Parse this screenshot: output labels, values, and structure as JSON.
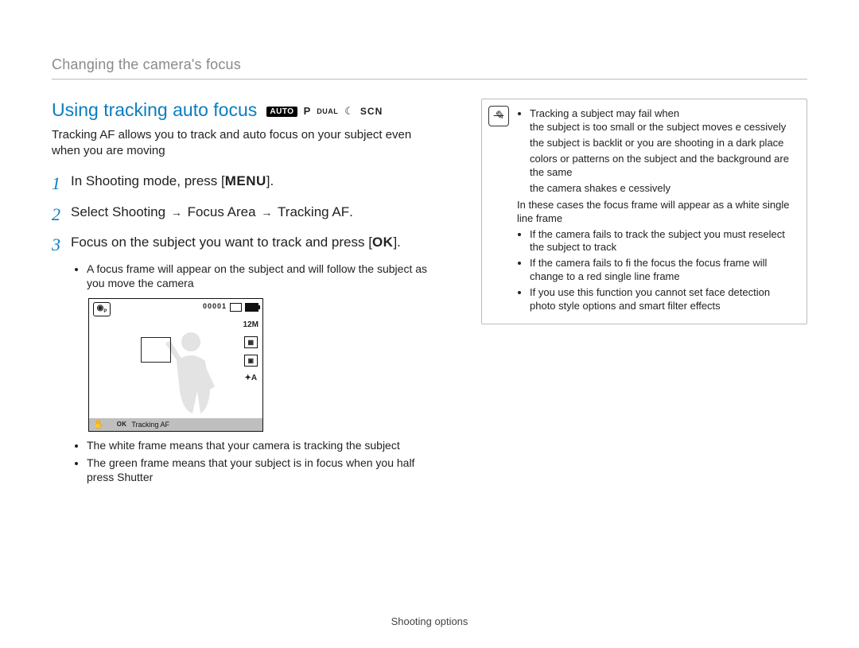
{
  "breadcrumb": "Changing the camera's focus",
  "section_title": "Using tracking auto focus",
  "mode_badges": {
    "auto": "AUTO",
    "p": "P",
    "dual": "DUAL",
    "moon": "☾",
    "scn": "SCN"
  },
  "intro": "Tracking AF allows you to track and auto focus on your subject even when you are moving",
  "steps": {
    "s1": {
      "num": "1",
      "pre": "In Shooting mode, press [",
      "key": "MENU",
      "post": "]."
    },
    "s2": {
      "num": "2",
      "pre": "Select ",
      "b1": "Shooting",
      "arrow": "→",
      "b2": "Focus Area",
      "b3": "Tracking AF",
      "post": "."
    },
    "s3": {
      "num": "3",
      "pre": "Focus on the subject you want to track and press [",
      "key": "OK",
      "post": "].",
      "sub1": "A focus frame will appear on the subject and will follow the subject as you move the camera"
    }
  },
  "lcd": {
    "counter": "00001",
    "res": "12M",
    "flash": "✦A",
    "bottom_ok": "OK",
    "bottom_label": "Tracking AF"
  },
  "after_lcd": {
    "b1": "The white frame means that your camera is tracking the subject",
    "b2_pre": "The green frame means that your subject is in focus when you half press ",
    "b2_bold": "Shutter"
  },
  "note": {
    "lead": "Tracking a subject may fail when",
    "reasons": [
      "the subject is too small or the subject moves e cessively",
      "the subject is backlit or you are shooting in a dark place",
      "colors or patterns on the subject and the background are the same",
      "the camera shakes e cessively"
    ],
    "note_after": "In these cases  the focus frame will appear as a white single line frame",
    "b2": "If the camera fails to track the subject  you must reselect the subject to track",
    "b3": "If the camera fails to fi  the focus  the focus frame will change to a red single line frame",
    "b4": "If you use this function  you cannot set face detection  photo style options  and smart filter effects"
  },
  "footer": "Shooting options"
}
